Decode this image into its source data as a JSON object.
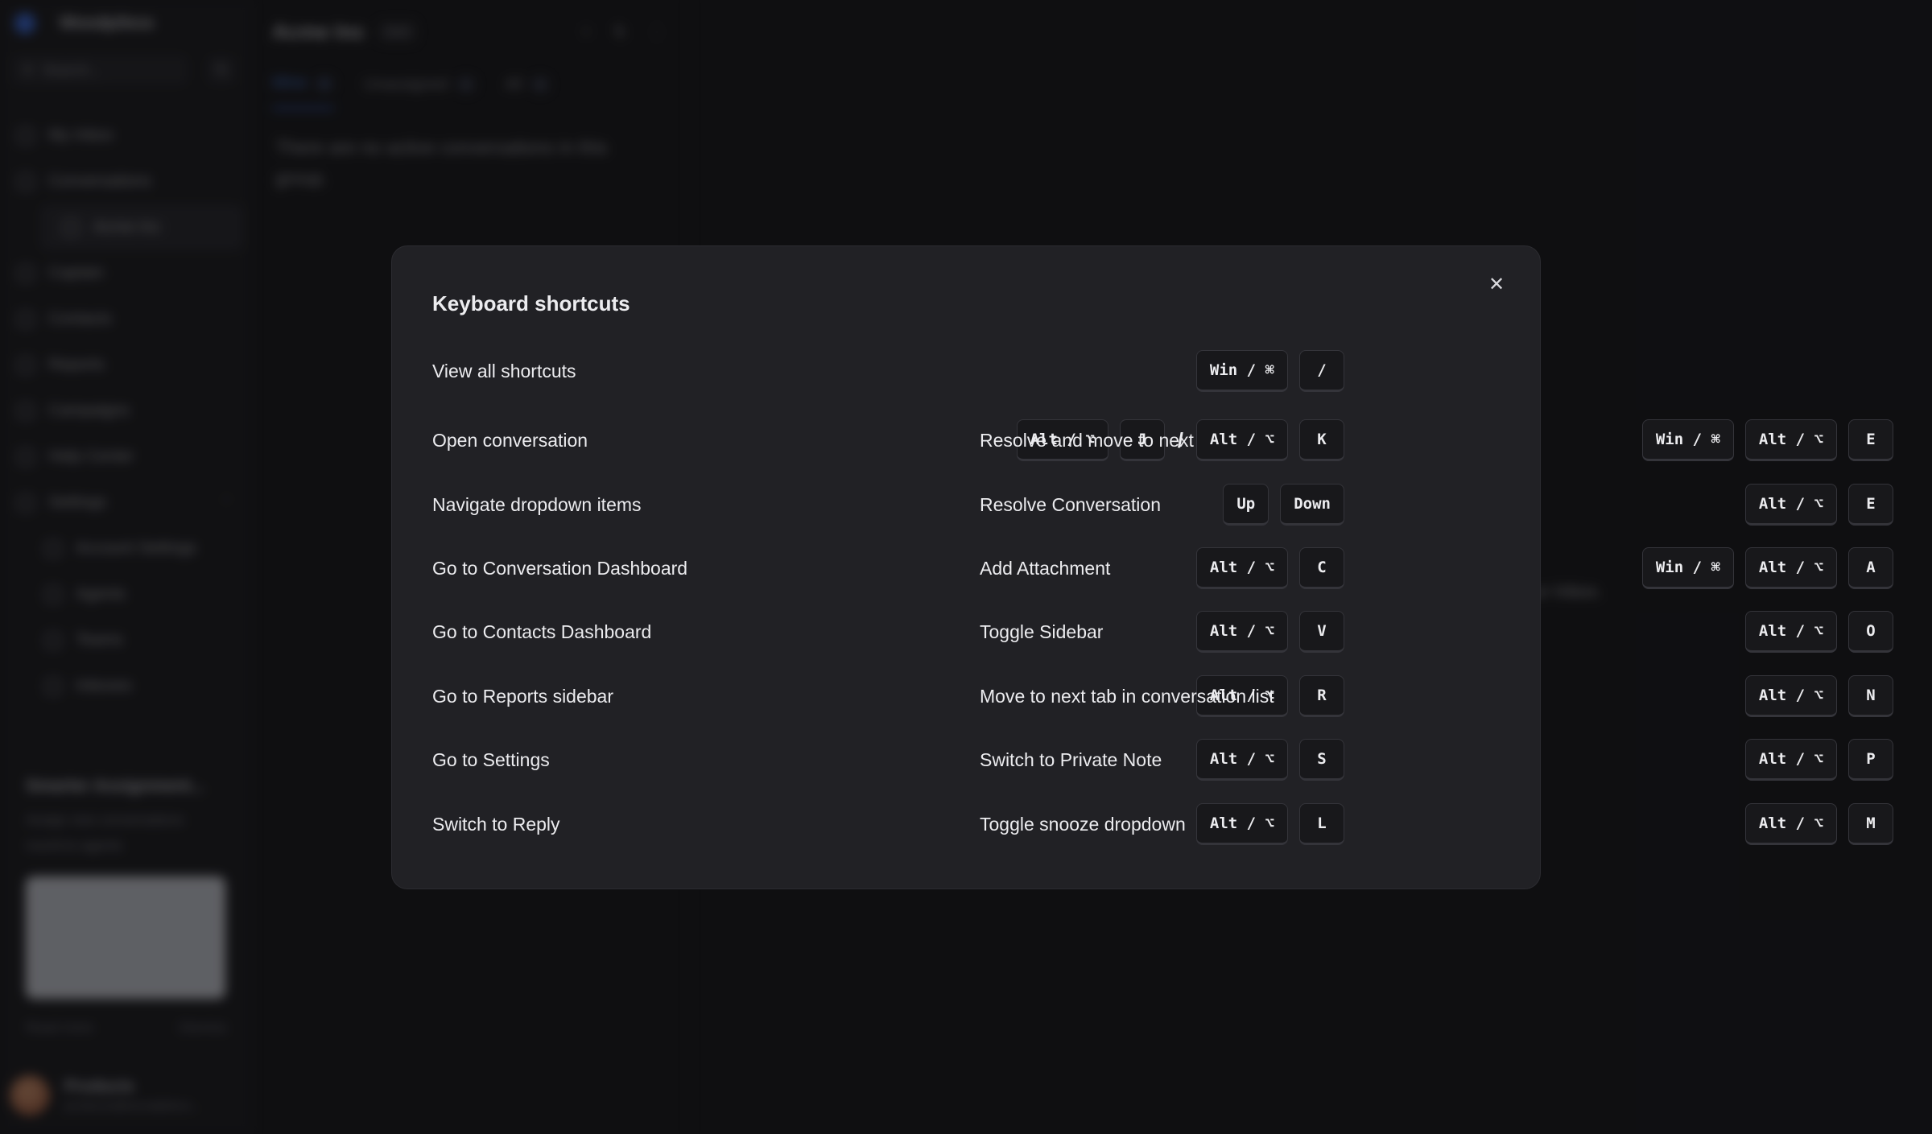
{
  "app": {
    "brand": "Woodpiless",
    "search_placeholder": "Search...",
    "nav": [
      {
        "label": "My Inbox"
      },
      {
        "label": "Conversations"
      },
      {
        "label": "Acme Inc"
      },
      {
        "label": "Captain"
      },
      {
        "label": "Contacts"
      },
      {
        "label": "Reports"
      },
      {
        "label": "Campaigns"
      },
      {
        "label": "Help Center"
      },
      {
        "label": "Settings"
      },
      {
        "label": "Account Settings"
      },
      {
        "label": "Agents"
      },
      {
        "label": "Teams"
      },
      {
        "label": "Inboxes"
      }
    ],
    "promo": {
      "title": "Smarter Assignment...",
      "description": "Assign new conversations round-to-agents",
      "read_more": "Read more",
      "dismiss": "Dismiss"
    },
    "user": {
      "name": "Products",
      "email": "products@woodpiless..."
    },
    "inbox_title": "Acme Inc",
    "sort_chip": "Sort",
    "tabs": [
      {
        "label": "Mine",
        "count": "0"
      },
      {
        "label": "Unassigned",
        "count": "0"
      },
      {
        "label": "All",
        "count": "0"
      }
    ],
    "empty_message": "There are no active conversations in this group.",
    "side_text": "ur Inbox."
  },
  "modal": {
    "title": "Keyboard shortcuts",
    "close_icon": "x",
    "shortcuts": {
      "view_all": {
        "label": "View all shortcuts",
        "keys": [
          "Win / ⌘",
          "/"
        ]
      },
      "open_conversation": {
        "label": "Open conversation",
        "keys": [
          "Alt / ⌥",
          "J",
          "Alt / ⌥",
          "K"
        ],
        "separator": "/"
      },
      "resolve_next": {
        "label": "Resolve and move to next",
        "keys": [
          "Win / ⌘",
          "Alt / ⌥",
          "E"
        ]
      },
      "navigate_dropdown": {
        "label": "Navigate dropdown items",
        "keys": [
          "Up",
          "Down"
        ]
      },
      "resolve_conversation": {
        "label": "Resolve Conversation",
        "keys": [
          "Alt / ⌥",
          "E"
        ]
      },
      "go_conversation_dashboard": {
        "label": "Go to Conversation Dashboard",
        "keys": [
          "Alt / ⌥",
          "C"
        ]
      },
      "add_attachment": {
        "label": "Add Attachment",
        "keys": [
          "Win / ⌘",
          "Alt / ⌥",
          "A"
        ]
      },
      "go_contacts_dashboard": {
        "label": "Go to Contacts Dashboard",
        "keys": [
          "Alt / ⌥",
          "V"
        ]
      },
      "toggle_sidebar": {
        "label": "Toggle Sidebar",
        "keys": [
          "Alt / ⌥",
          "O"
        ]
      },
      "go_reports_sidebar": {
        "label": "Go to Reports sidebar",
        "keys": [
          "Alt / ⌥",
          "R"
        ]
      },
      "next_tab": {
        "label": "Move to next tab in conversation list",
        "keys": [
          "Alt / ⌥",
          "N"
        ]
      },
      "go_settings": {
        "label": "Go to Settings",
        "keys": [
          "Alt / ⌥",
          "S"
        ]
      },
      "private_note": {
        "label": "Switch to Private Note",
        "keys": [
          "Alt / ⌥",
          "P"
        ]
      },
      "switch_reply": {
        "label": "Switch to Reply",
        "keys": [
          "Alt / ⌥",
          "L"
        ]
      },
      "toggle_snooze": {
        "label": "Toggle snooze dropdown",
        "keys": [
          "Alt / ⌥",
          "M"
        ]
      }
    }
  }
}
